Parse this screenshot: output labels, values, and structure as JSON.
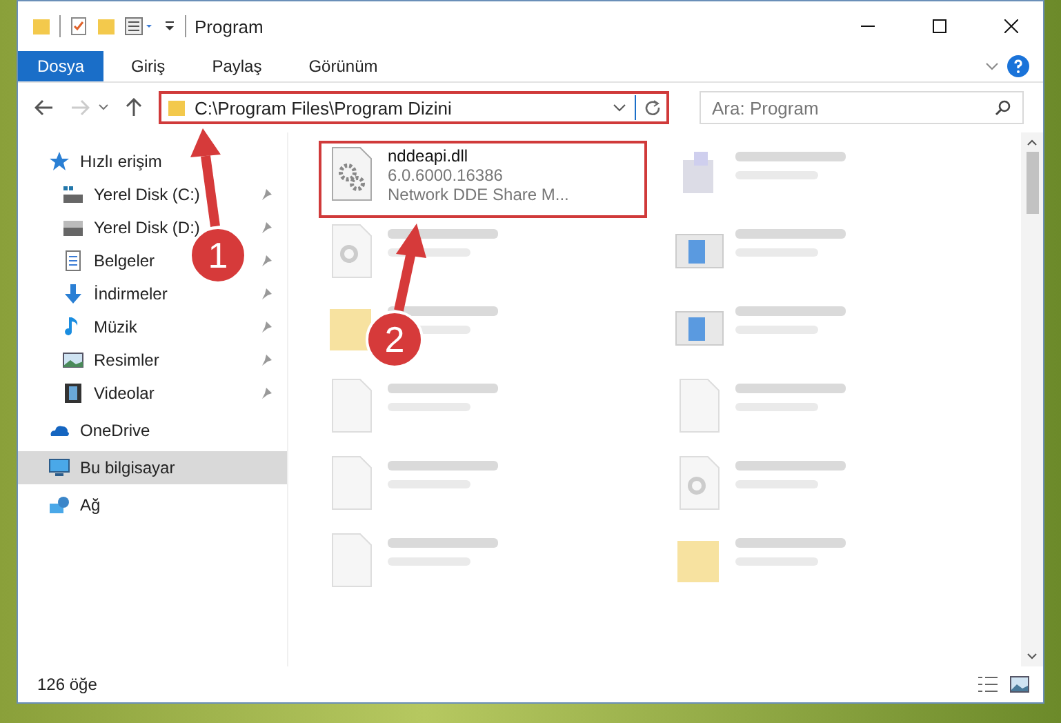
{
  "window": {
    "title": "Program"
  },
  "ribbon": {
    "tabs": [
      {
        "label": "Dosya",
        "selected": true
      },
      {
        "label": "Giriş",
        "selected": false
      },
      {
        "label": "Paylaş",
        "selected": false
      },
      {
        "label": "Görünüm",
        "selected": false
      }
    ]
  },
  "address_bar": {
    "path": "C:\\Program Files\\Program Dizini",
    "highlighted": true
  },
  "search": {
    "placeholder": "Ara: Program"
  },
  "sidebar": {
    "items": [
      {
        "label": "Hızlı erişim",
        "kind": "star",
        "selected": false,
        "children": [
          {
            "label": "Yerel Disk (C:)",
            "kind": "drive-c",
            "pinned": true
          },
          {
            "label": "Yerel Disk (D:)",
            "kind": "drive",
            "pinned": true
          },
          {
            "label": "Belgeler",
            "kind": "document",
            "pinned": true
          },
          {
            "label": "İndirmeler",
            "kind": "download",
            "pinned": true
          },
          {
            "label": "Müzik",
            "kind": "music",
            "pinned": true
          },
          {
            "label": "Resimler",
            "kind": "picture",
            "pinned": true
          },
          {
            "label": "Videolar",
            "kind": "film",
            "pinned": true
          }
        ]
      },
      {
        "label": "OneDrive",
        "kind": "cloud",
        "selected": false
      },
      {
        "label": "Bu bilgisayar",
        "kind": "monitor",
        "selected": true
      },
      {
        "label": "Ağ",
        "kind": "network",
        "selected": false
      }
    ]
  },
  "files": [
    {
      "name": "nddeapi.dll",
      "lines": [
        "6.0.6000.16386",
        "Network DDE Share M..."
      ],
      "kind": "dll",
      "highlighted": true
    }
  ],
  "blurred_files": [
    {
      "kind": "setup"
    },
    {
      "kind": "dll"
    },
    {
      "kind": "app"
    },
    {
      "kind": "folder"
    },
    {
      "kind": "app"
    },
    {
      "kind": "file"
    },
    {
      "kind": "file"
    },
    {
      "kind": "file"
    },
    {
      "kind": "dll"
    },
    {
      "kind": "file"
    },
    {
      "kind": "folder"
    }
  ],
  "status_bar": {
    "count": "126 öğe"
  },
  "callouts": [
    {
      "label": "1"
    },
    {
      "label": "2"
    }
  ]
}
